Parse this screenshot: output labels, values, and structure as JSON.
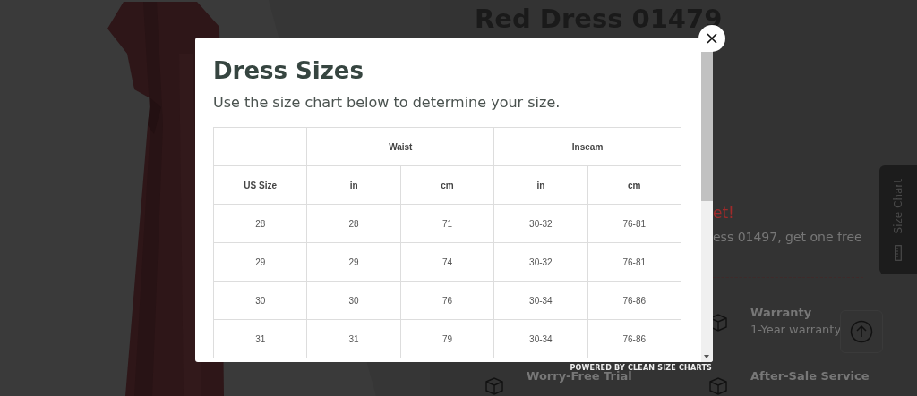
{
  "product": {
    "title": "Red Dress 01479",
    "promo": {
      "heading": "et!",
      "text": "ess 01497, get one free"
    },
    "features": [
      {
        "title": "Warranty",
        "subtitle": "1-Year warranty"
      },
      {
        "title": "Worry-Free Trial"
      },
      {
        "title": "After-Sale Service"
      }
    ]
  },
  "size_chart_tab": {
    "label": "Size Chart"
  },
  "modal": {
    "title": "Dress Sizes",
    "subtitle": "Use the size chart below to determine your size.",
    "table": {
      "groups": [
        "Waist",
        "Inseam"
      ],
      "columns": [
        "US Size",
        "in",
        "cm",
        "in",
        "cm"
      ],
      "rows": [
        [
          "28",
          "28",
          "71",
          "30-32",
          "76-81"
        ],
        [
          "29",
          "29",
          "74",
          "30-32",
          "76-81"
        ],
        [
          "30",
          "30",
          "76",
          "30-34",
          "76-86"
        ],
        [
          "31",
          "31",
          "79",
          "30-34",
          "76-86"
        ]
      ]
    },
    "footer": "POWERED BY CLEAN SIZE CHARTS"
  }
}
